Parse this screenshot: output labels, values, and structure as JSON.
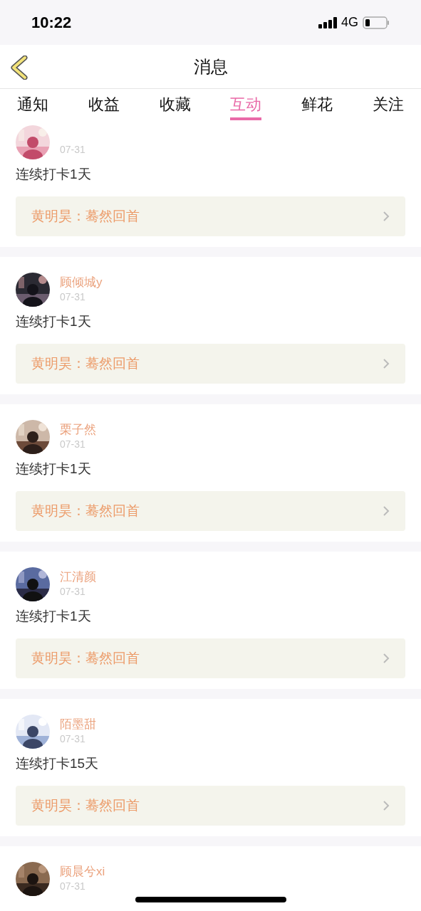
{
  "status_bar": {
    "time": "10:22",
    "network": "4G"
  },
  "header": {
    "title": "消息"
  },
  "tabs": [
    {
      "label": "通知",
      "selected": false
    },
    {
      "label": "收益",
      "selected": false
    },
    {
      "label": "收藏",
      "selected": false
    },
    {
      "label": "互动",
      "selected": true
    },
    {
      "label": "鲜花",
      "selected": false
    },
    {
      "label": "关注",
      "selected": false
    }
  ],
  "messages": [
    {
      "date": "07-31",
      "text": "连续打卡1天",
      "quote": "黄明昊：蓦然回首"
    },
    {
      "name": "顾倾城y",
      "date": "07-31",
      "text": "连续打卡1天",
      "quote": "黄明昊：蓦然回首"
    },
    {
      "name": "栗子然",
      "date": "07-31",
      "text": "连续打卡1天",
      "quote": "黄明昊：蓦然回首"
    },
    {
      "name": "江清颜",
      "date": "07-31",
      "text": "连续打卡1天",
      "quote": "黄明昊：蓦然回首"
    },
    {
      "name": "陌墨甜",
      "date": "07-31",
      "text": "连续打卡15天",
      "quote": "黄明昊：蓦然回首"
    },
    {
      "name": "顾晨兮xi",
      "date": "07-31"
    }
  ]
}
